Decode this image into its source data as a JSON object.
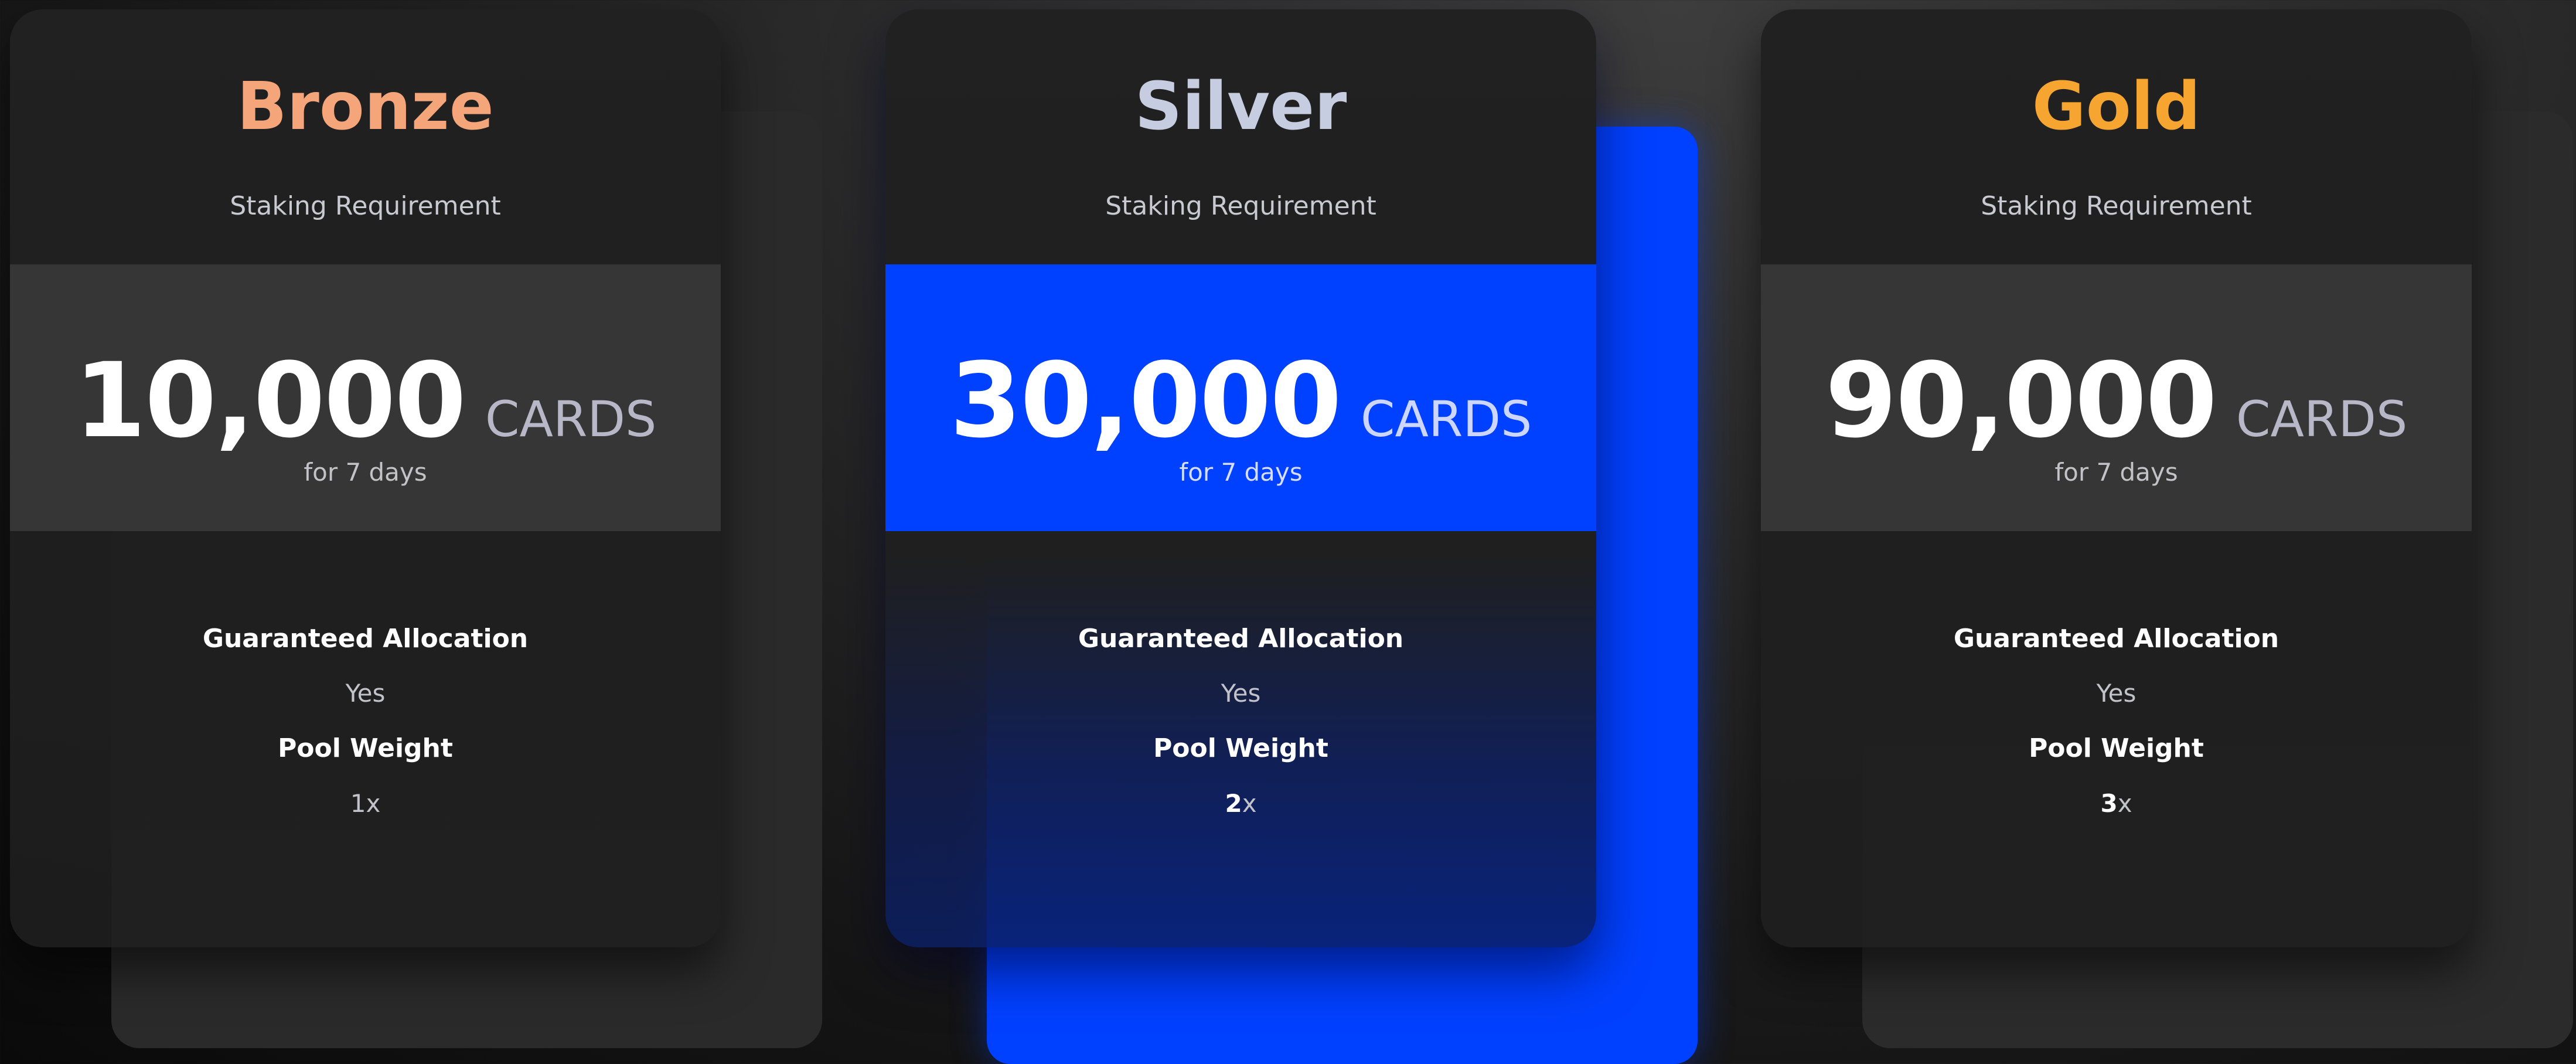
{
  "tiers": [
    {
      "name": "Bronze",
      "color": "#f4a57a",
      "subtitle": "Staking Requirement",
      "amount": "10,000",
      "unit": "CARDS",
      "period": "for 7 days",
      "features": {
        "allocation_label": "Guaranteed Allocation",
        "allocation_value": "Yes",
        "weight_label": "Pool Weight",
        "weight_number": "1",
        "weight_suffix": "x"
      }
    },
    {
      "name": "Silver",
      "color": "#c6cde0",
      "highlight_color": "#0040ff",
      "subtitle": "Staking Requirement",
      "amount": "30,000",
      "unit": "CARDS",
      "period": "for 7 days",
      "features": {
        "allocation_label": "Guaranteed Allocation",
        "allocation_value": "Yes",
        "weight_label": "Pool Weight",
        "weight_number": "2",
        "weight_suffix": "x"
      }
    },
    {
      "name": "Gold",
      "color": "#f7a531",
      "subtitle": "Staking Requirement",
      "amount": "90,000",
      "unit": "CARDS",
      "period": "for 7 days",
      "features": {
        "allocation_label": "Guaranteed Allocation",
        "allocation_value": "Yes",
        "weight_label": "Pool Weight",
        "weight_number": "3",
        "weight_suffix": "x"
      }
    }
  ]
}
